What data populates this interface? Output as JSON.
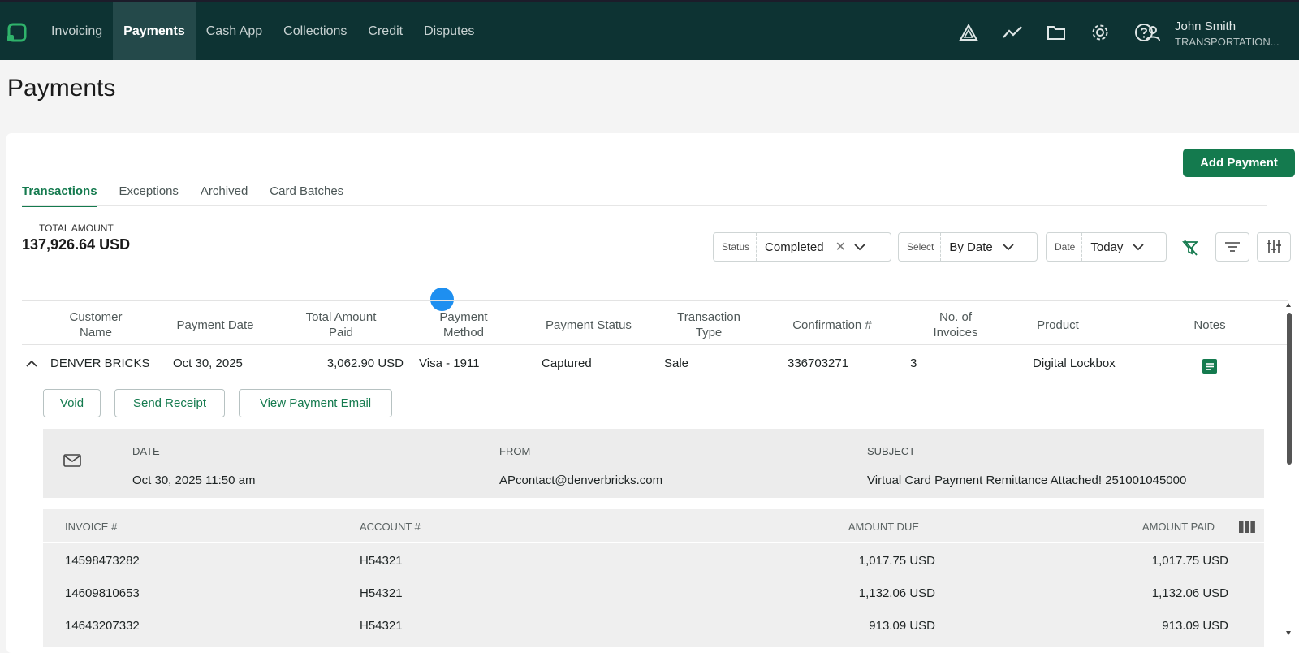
{
  "nav": {
    "items": [
      "Invoicing",
      "Payments",
      "Cash App",
      "Collections",
      "Credit",
      "Disputes"
    ],
    "active": "Payments"
  },
  "user": {
    "name": "John Smith",
    "org": "TRANSPORTATION..."
  },
  "page": {
    "title": "Payments"
  },
  "actions": {
    "add_payment": "Add Payment"
  },
  "tabs": [
    "Transactions",
    "Exceptions",
    "Archived",
    "Card Batches"
  ],
  "summary": {
    "total_label": "TOTAL AMOUNT",
    "total_value": "137,926.64 USD"
  },
  "filters": {
    "status": {
      "label": "Status",
      "value": "Completed"
    },
    "select": {
      "label": "Select",
      "value": "By Date"
    },
    "date": {
      "label": "Date",
      "value": "Today"
    }
  },
  "table": {
    "headers": {
      "customer_1": "Customer",
      "customer_2": "Name",
      "payment_date": "Payment Date",
      "total_1": "Total Amount",
      "total_2": "Paid",
      "method_1": "Payment",
      "method_2": "Method",
      "status": "Payment Status",
      "type_1": "Transaction",
      "type_2": "Type",
      "confirmation": "Confirmation #",
      "invoices_1": "No. of",
      "invoices_2": "Invoices",
      "product": "Product",
      "notes": "Notes"
    },
    "row": {
      "customer": "DENVER BRICKS",
      "date": "Oct 30, 2025",
      "amount": "3,062.90 USD",
      "method": "Visa - 1911",
      "status": "Captured",
      "type": "Sale",
      "confirmation": "336703271",
      "invoices": "3",
      "product": "Digital Lockbox"
    },
    "row_actions": {
      "void": "Void",
      "send_receipt": "Send Receipt",
      "view_email": "View Payment Email"
    }
  },
  "email": {
    "date_label": "DATE",
    "date": "Oct 30, 2025 11:50 am",
    "from_label": "FROM",
    "from": "APcontact@denverbricks.com",
    "subject_label": "SUBJECT",
    "subject": "Virtual Card Payment Remittance Attached! 251001045000"
  },
  "invoices": {
    "headers": {
      "invoice": "INVOICE #",
      "account": "ACCOUNT #",
      "amount_due": "AMOUNT DUE",
      "amount_paid": "AMOUNT PAID"
    },
    "rows": [
      {
        "invoice": "14598473282",
        "account": "H54321",
        "due": "1,017.75 USD",
        "paid": "1,017.75 USD"
      },
      {
        "invoice": "14609810653",
        "account": "H54321",
        "due": "1,132.06 USD",
        "paid": "1,132.06 USD"
      },
      {
        "invoice": "14643207332",
        "account": "H54321",
        "due": "913.09 USD",
        "paid": "913.09 USD"
      }
    ]
  },
  "colors": {
    "header_bg": "#0d3333",
    "accent": "#147a4e",
    "cursor": "#1e8ff0"
  },
  "icons": [
    "app-logo-icon",
    "alert-triangle-icon",
    "trend-line-icon",
    "folder-icon",
    "gear-icon",
    "help-icon",
    "user-icon",
    "chevron-down-icon",
    "close-icon",
    "filter-clear-icon",
    "filter-icon",
    "column-settings-icon",
    "chevron-up-icon",
    "notes-icon",
    "mail-icon",
    "columns-icon"
  ]
}
